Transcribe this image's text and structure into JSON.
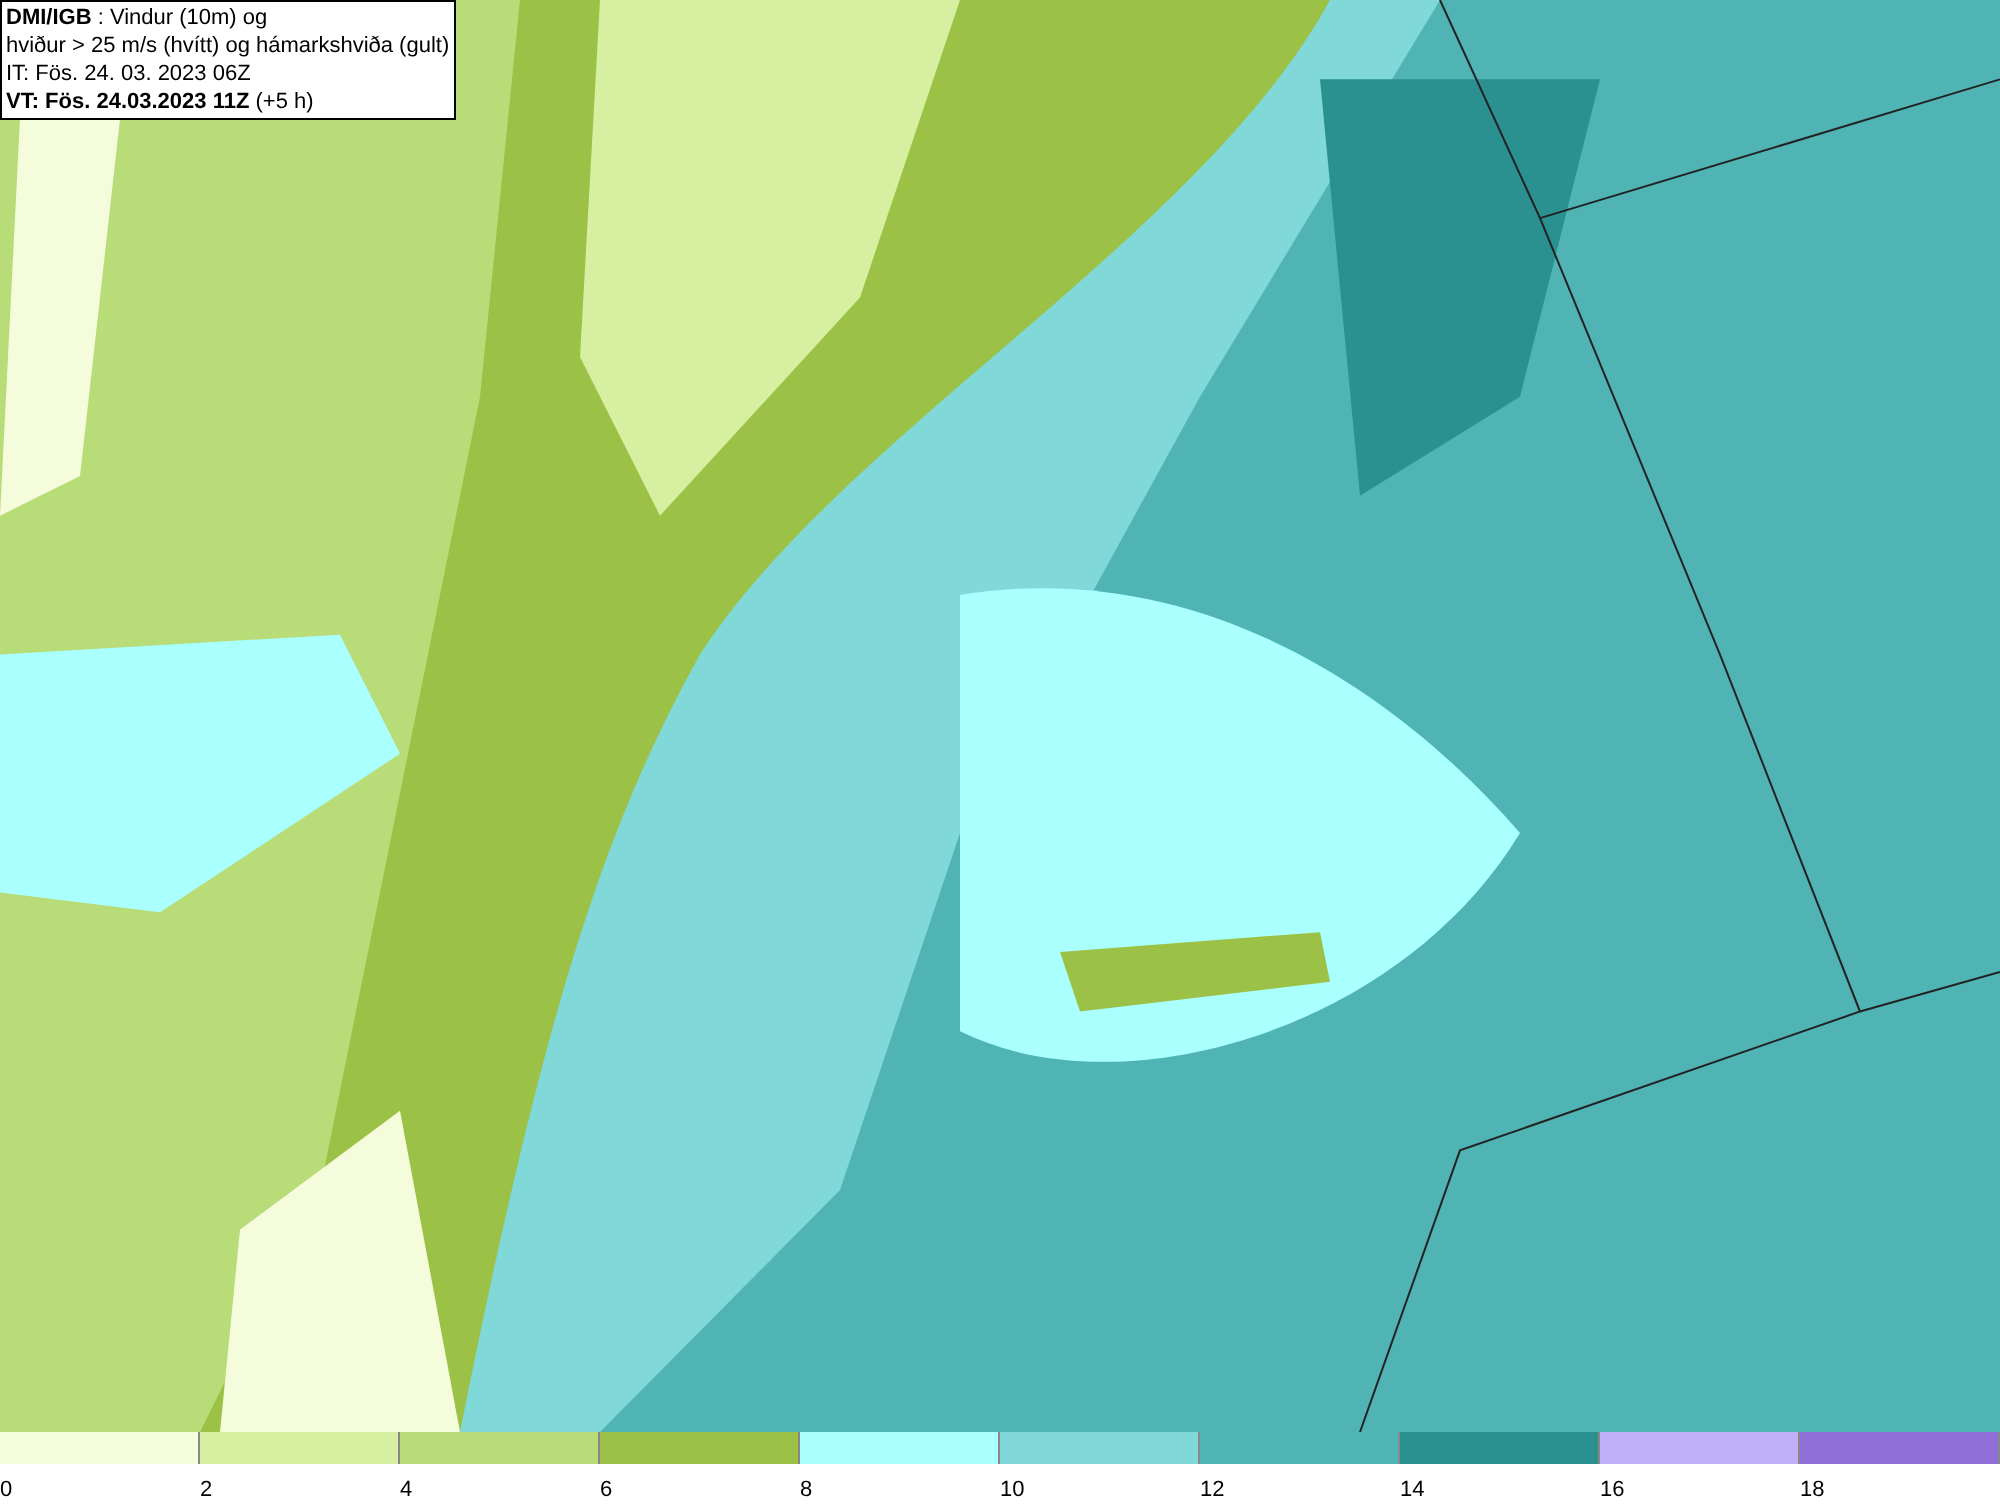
{
  "title_box": {
    "lines": [
      "**DMI/IGB** : Vindur (10m) og",
      "hviður > 25 m/s (hvítt) og hámarkshviða (gult)",
      "IT: Fös. 24. 03. 2023 06Z",
      "**VT: Fös. 24.03.2023 11Z** (+5 h)"
    ]
  },
  "legend": {
    "bins": [
      {
        "label": "0",
        "color": "#f5fcdc"
      },
      {
        "label": "2",
        "color": "#d6efa0"
      },
      {
        "label": "4",
        "color": "#b8dc78"
      },
      {
        "label": "6",
        "color": "#9bc146"
      },
      {
        "label": "8",
        "color": "#aaffff"
      },
      {
        "label": "10",
        "color": "#80d8d8"
      },
      {
        "label": "12",
        "color": "#50b4b4"
      },
      {
        "label": "14",
        "color": "#2a9090"
      },
      {
        "label": "16",
        "color": "#c0b0f8"
      },
      {
        "label": "18",
        "color": "#9070d8"
      }
    ]
  }
}
